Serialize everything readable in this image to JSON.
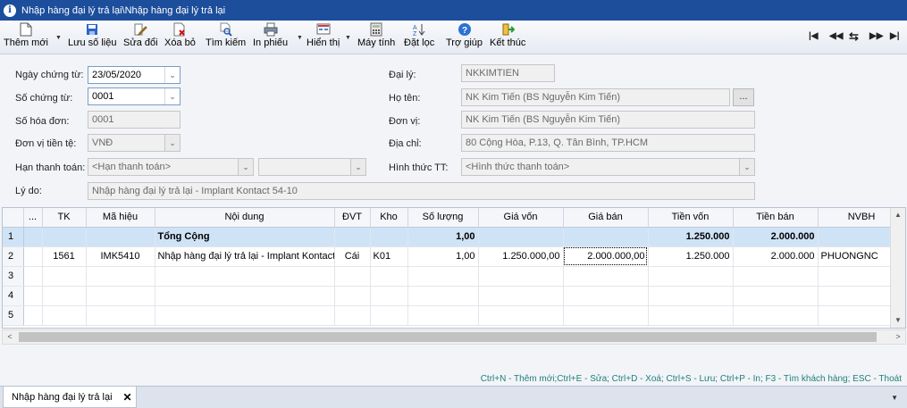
{
  "window": {
    "title": "Nhập hàng đại lý trả lại\\Nhập hàng đại lý trả lại"
  },
  "toolbar": {
    "buttons": [
      {
        "label": "Thêm mới",
        "icon": "new-document-icon"
      },
      {
        "label": "Lưu số liệu",
        "icon": "save-icon"
      },
      {
        "label": "Sửa đổi",
        "icon": "edit-icon"
      },
      {
        "label": "Xóa bỏ",
        "icon": "delete-icon"
      },
      {
        "label": "Tìm kiếm",
        "icon": "search-icon"
      },
      {
        "label": "In phiếu",
        "icon": "print-icon"
      },
      {
        "label": "Hiển thị",
        "icon": "display-icon"
      },
      {
        "label": "Máy tính",
        "icon": "calculator-icon"
      },
      {
        "label": "Đặt lọc",
        "icon": "filter-sort-icon"
      },
      {
        "label": "Trợ giúp",
        "icon": "help-icon"
      },
      {
        "label": "Kết thúc",
        "icon": "exit-icon"
      }
    ],
    "nav": [
      "first-icon",
      "prev-icon",
      "refresh-icon",
      "next-icon",
      "last-icon"
    ]
  },
  "form": {
    "ngay_chung_tu": {
      "label": "Ngày chứng từ:",
      "value": "23/05/2020"
    },
    "so_chung_tu": {
      "label": "Số chứng từ:",
      "value": "0001"
    },
    "so_hoa_don": {
      "label": "Số hóa đơn:",
      "value": "0001"
    },
    "don_vi_tien_te": {
      "label": "Đơn vị tiền tệ:",
      "value": "VNĐ"
    },
    "han_thanh_toan": {
      "label": "Hạn thanh toán:",
      "value": "<Hạn thanh toán>",
      "value2": ""
    },
    "ly_do": {
      "label": "Lý do:",
      "value": "Nhập hàng đại lý trả lại - Implant Kontact 54-10"
    },
    "dai_ly": {
      "label": "Đại lý:",
      "value": "NKKIMTIEN"
    },
    "ho_ten": {
      "label": "Họ tên:",
      "value": "NK Kim Tiến (BS Nguyễn Kim Tiến)",
      "button": "..."
    },
    "don_vi": {
      "label": "Đơn vị:",
      "value": "NK Kim Tiến (BS Nguyễn Kim Tiến)"
    },
    "dia_chi": {
      "label": "Địa chỉ:",
      "value": "80 Cộng Hòa, P.13, Q. Tân Bình, TP.HCM"
    },
    "hinh_thuc_tt": {
      "label": "Hình thức TT:",
      "value": "<Hình thức thanh toán>"
    }
  },
  "grid": {
    "columns": [
      "",
      "...",
      "TK",
      "Mã hiệu",
      "Nội dung",
      "ĐVT",
      "Kho",
      "Số lượng",
      "Giá vốn",
      "Giá bán",
      "Tiền vốn",
      "Tiền bán",
      "NVBH"
    ],
    "rows": [
      [
        "1",
        "",
        "",
        "",
        "Tổng Cộng",
        "",
        "",
        "1,00",
        "",
        "",
        "1.250.000",
        "2.000.000",
        ""
      ],
      [
        "2",
        "",
        "1561",
        "IMK5410",
        "Nhập hàng đại lý trả lại - Implant Kontact",
        "Cái",
        "K01",
        "1,00",
        "1.250.000,00",
        "2.000.000,00",
        "1.250.000",
        "2.000.000",
        "PHUONGNC"
      ],
      [
        "3",
        "",
        "",
        "",
        "",
        "",
        "",
        "",
        "",
        "",
        "",
        "",
        ""
      ],
      [
        "4",
        "",
        "",
        "",
        "",
        "",
        "",
        "",
        "",
        "",
        "",
        "",
        ""
      ],
      [
        "5",
        "",
        "",
        "",
        "",
        "",
        "",
        "",
        "",
        "",
        "",
        "",
        ""
      ]
    ]
  },
  "shortcuts": "Ctrl+N - Thêm mới;Ctrl+E - Sửa; Ctrl+D - Xoá; Ctrl+S - Lưu; Ctrl+P - In; F3 - Tìm khách hàng; ESC - Thoát",
  "tabs": [
    {
      "label": "Nhập hàng đại lý trả lại",
      "close": "✕"
    }
  ],
  "colors": {
    "titlebar": "#1d4e9c",
    "total_row": "#cfe3f6",
    "shortcut_text": "#1f7f7a"
  }
}
